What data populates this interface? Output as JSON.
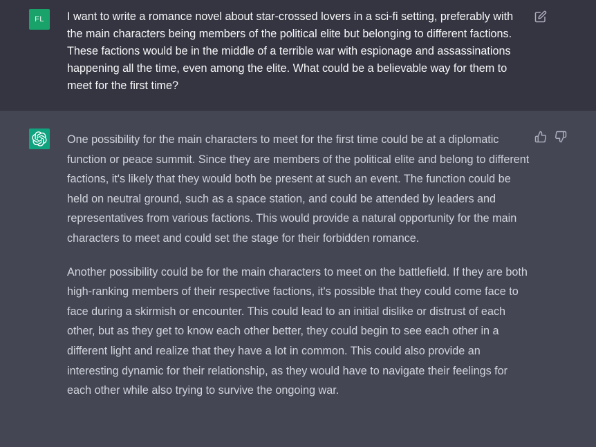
{
  "user_message": {
    "avatar_initials": "FL",
    "text": "I want to write a romance novel about star-crossed lovers in a sci-fi setting, preferably with the main characters being members of the political elite but belonging to different factions. These factions would be in the middle of a terrible war with espionage and assassinations happening all the time, even among the elite. What could be a believable way for them to meet for the first time?",
    "edit_icon": "edit-icon"
  },
  "assistant_message": {
    "avatar_icon": "openai-logo-icon",
    "paragraphs": [
      "One possibility for the main characters to meet for the first time could be at a diplomatic function or peace summit. Since they are members of the political elite and belong to different factions, it's likely that they would both be present at such an event. The function could be held on neutral ground, such as a space station, and could be attended by leaders and representatives from various factions. This would provide a natural opportunity for the main characters to meet and could set the stage for their forbidden romance.",
      "Another possibility could be for the main characters to meet on the battlefield. If they are both high-ranking members of their respective factions, it's possible that they could come face to face during a skirmish or encounter. This could lead to an initial dislike or distrust of each other, but as they get to know each other better, they could begin to see each other in a different light and realize that they have a lot in common. This could also provide an interesting dynamic for their relationship, as they would have to navigate their feelings for each other while also trying to survive the ongoing war."
    ],
    "feedback_icons": [
      "thumbs-up-icon",
      "thumbs-down-icon"
    ]
  },
  "colors": {
    "user_bg": "#343541",
    "assistant_bg": "#444654",
    "user_avatar": "#19a36b",
    "bot_avatar": "#10a37f"
  }
}
